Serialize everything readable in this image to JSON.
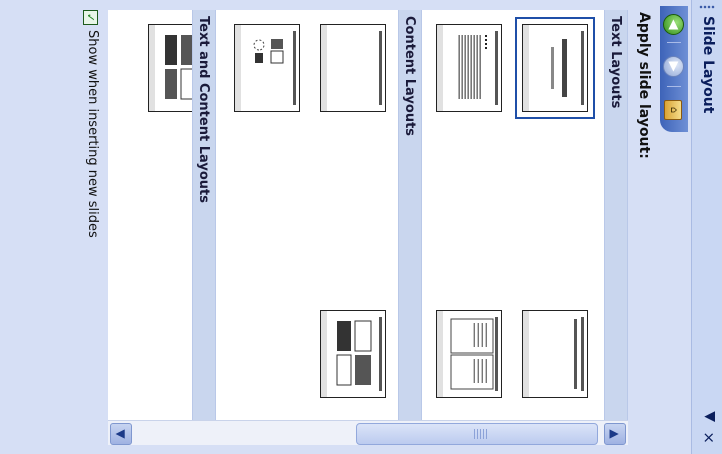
{
  "pane": {
    "title": "Slide Layout",
    "dropdown_glyph": "▼",
    "close_glyph": "×",
    "nav": {
      "back_icon": "◀",
      "forward_icon": "▶",
      "home_icon": "⌂"
    },
    "apply_label": "Apply slide layout:"
  },
  "sections": {
    "text_layouts": "Text Layouts",
    "content_layouts": "Content Layouts",
    "text_and_content_layouts": "Text and Content Layouts"
  },
  "scrollbar": {
    "up_glyph": "▲",
    "down_glyph": "▼"
  },
  "footer": {
    "checkbox_checked": "✓",
    "checkbox_label": "Show when inserting new slides"
  },
  "colors": {
    "pane_bg": "#d6dff5",
    "section_bg": "#c9d6ee",
    "selected_outline": "#1f4fa8",
    "title_text": "#0a1e5c"
  }
}
